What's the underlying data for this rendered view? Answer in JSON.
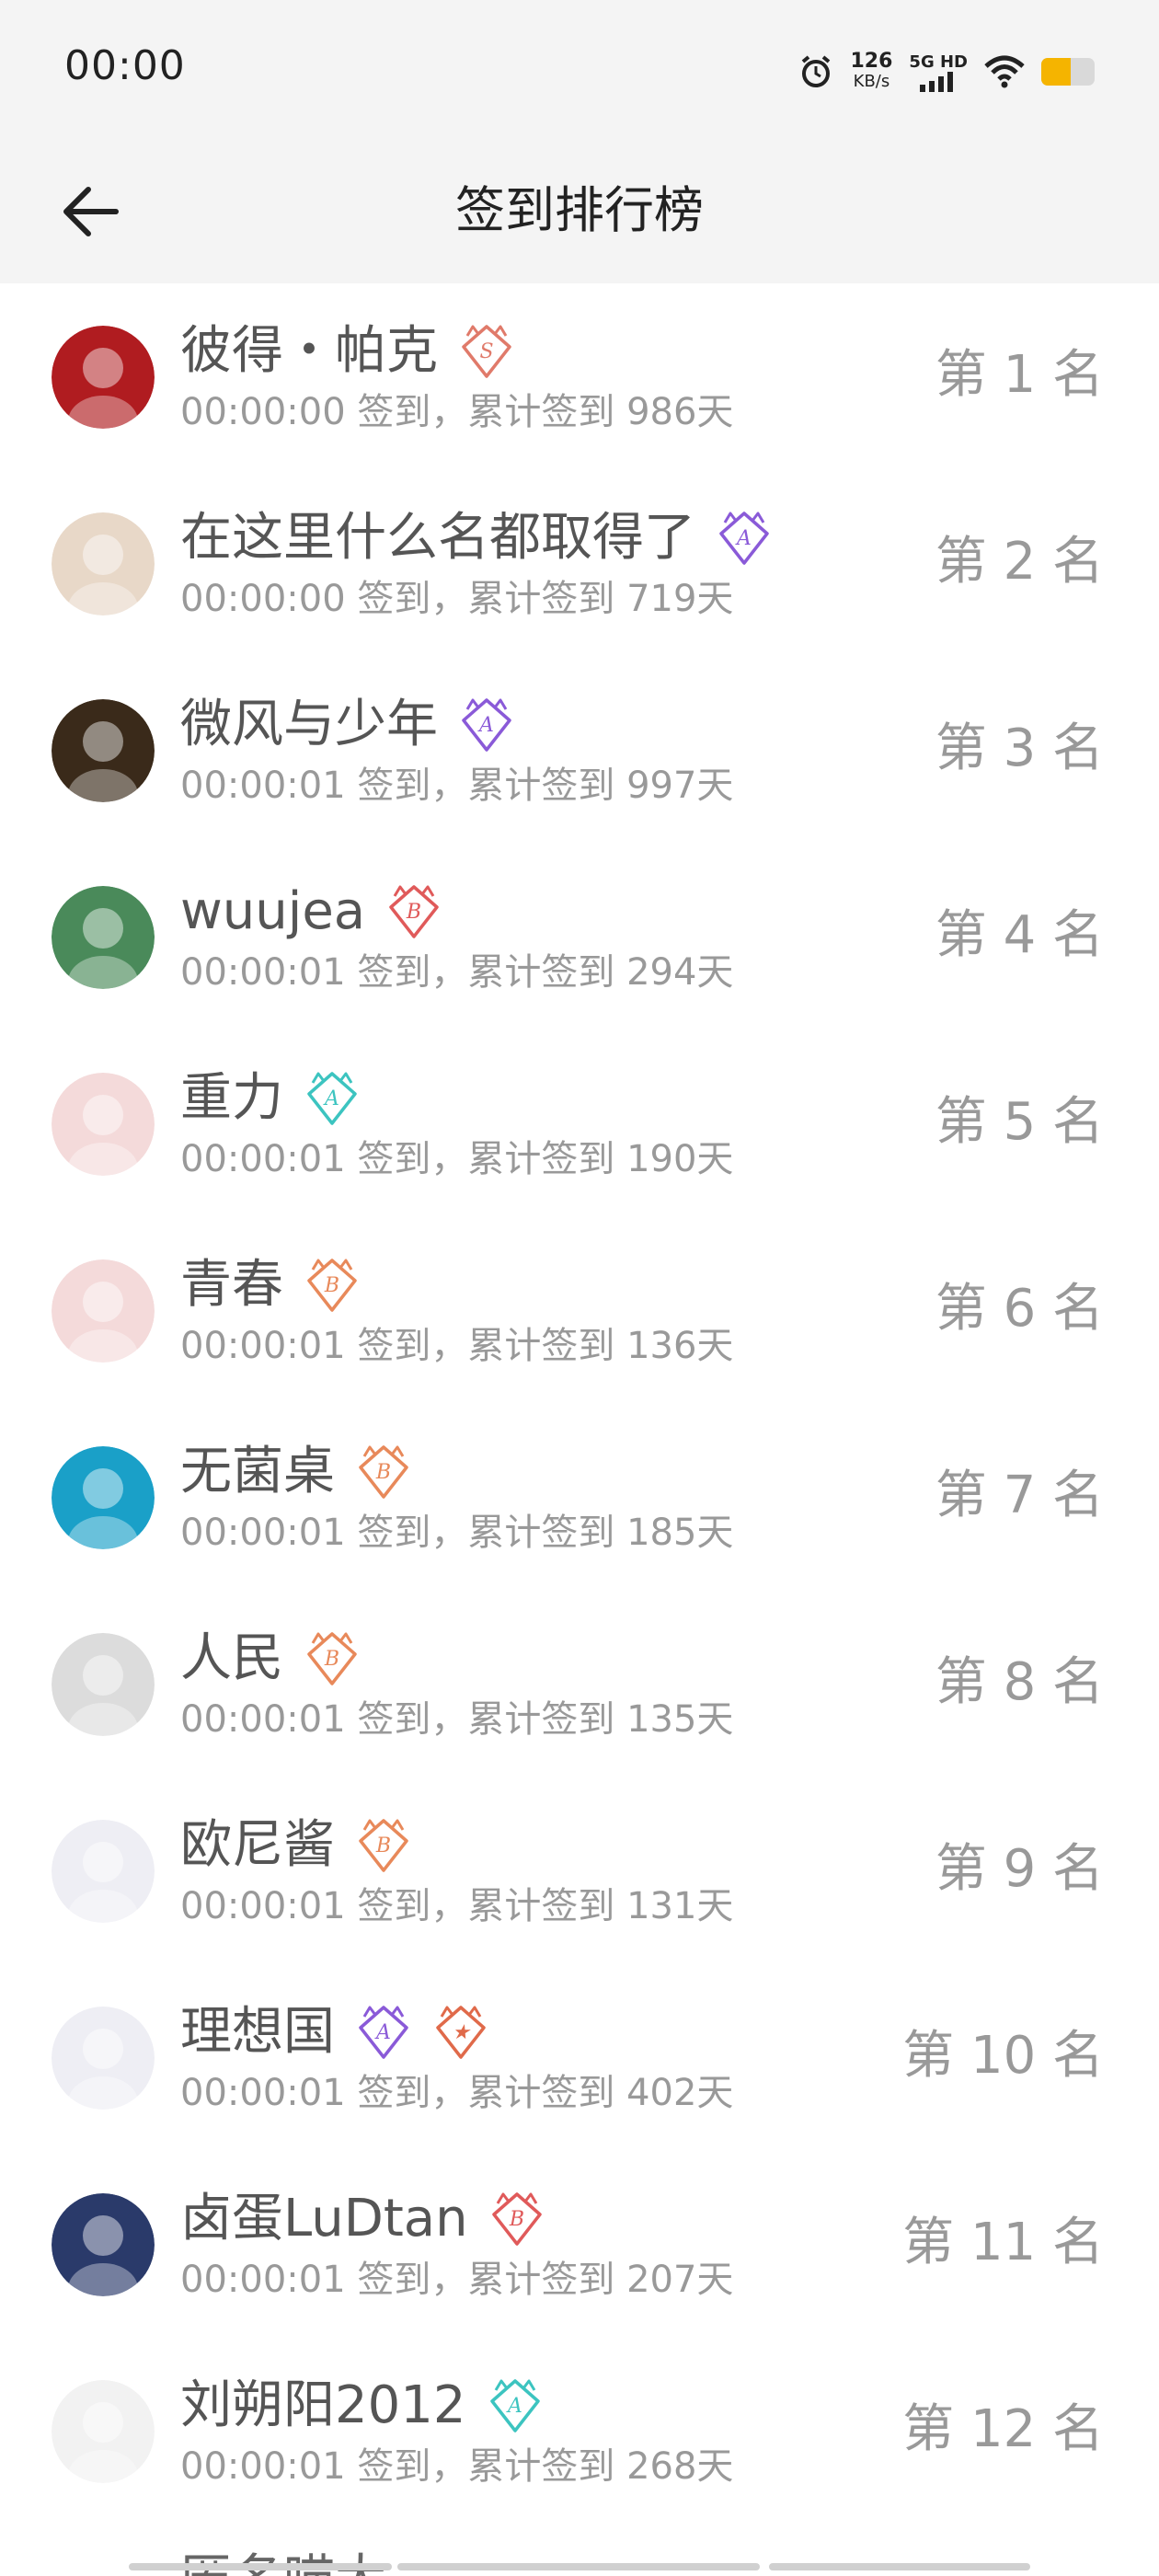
{
  "status_bar": {
    "time": "00:00",
    "speed_value": "126",
    "speed_unit": "KB/s",
    "network": "5G HD",
    "icons": [
      "alarm-icon",
      "signal-icon",
      "wifi-icon",
      "battery-icon"
    ],
    "battery_level": 0.55,
    "battery_color": "#f5b400"
  },
  "header": {
    "title": "签到排行榜",
    "back_icon": "arrow-left-icon"
  },
  "rows": [
    {
      "name": "彼得・帕克",
      "sub": "00:00:00 签到，累计签到 986天",
      "rank": "第 1 名",
      "badges": [
        {
          "letter": "S",
          "color": "#e07a6a"
        }
      ],
      "avatar": "#b01c20"
    },
    {
      "name": "在这里什么名都取得了",
      "sub": "00:00:00 签到，累计签到 719天",
      "rank": "第 2 名",
      "badges": [
        {
          "letter": "A",
          "color": "#8a5ad8"
        }
      ],
      "avatar": "#e8d8c8"
    },
    {
      "name": "微风与少年",
      "sub": "00:00:01 签到，累计签到 997天",
      "rank": "第 3 名",
      "badges": [
        {
          "letter": "A",
          "color": "#8a5ad8"
        }
      ],
      "avatar": "#3a2a1a"
    },
    {
      "name": "wuujea",
      "sub": "00:00:01 签到，累计签到 294天",
      "rank": "第 4 名",
      "badges": [
        {
          "letter": "B",
          "color": "#e05a5a"
        }
      ],
      "avatar": "#4a8a5a"
    },
    {
      "name": "重力",
      "sub": "00:00:01 签到，累计签到 190天",
      "rank": "第 5 名",
      "badges": [
        {
          "letter": "A",
          "color": "#3cc4c0"
        }
      ],
      "avatar": "#f4dada"
    },
    {
      "name": "青春",
      "sub": "00:00:01 签到，累计签到 136天",
      "rank": "第 6 名",
      "badges": [
        {
          "letter": "B",
          "color": "#e8895a"
        }
      ],
      "avatar": "#f4dada"
    },
    {
      "name": "无菌桌",
      "sub": "00:00:01 签到，累计签到 185天",
      "rank": "第 7 名",
      "badges": [
        {
          "letter": "B",
          "color": "#e8895a"
        }
      ],
      "avatar": "#1aa0c8"
    },
    {
      "name": "人民",
      "sub": "00:00:01 签到，累计签到 135天",
      "rank": "第 8 名",
      "badges": [
        {
          "letter": "B",
          "color": "#e8895a"
        }
      ],
      "avatar": "#dcdcdc"
    },
    {
      "name": "欧尼酱",
      "sub": "00:00:01 签到，累计签到 131天",
      "rank": "第 9 名",
      "badges": [
        {
          "letter": "B",
          "color": "#e8895a"
        }
      ],
      "avatar": "#eeeef4"
    },
    {
      "name": "理想国",
      "sub": "00:00:01 签到，累计签到 402天",
      "rank": "第 10 名",
      "badges": [
        {
          "letter": "A",
          "color": "#8a5ad8"
        },
        {
          "letter": "★",
          "color": "#e06a4a"
        }
      ],
      "avatar": "#eeeef4"
    },
    {
      "name": "卤蛋LuDtan",
      "sub": "00:00:01 签到，累计签到 207天",
      "rank": "第 11 名",
      "badges": [
        {
          "letter": "B",
          "color": "#e05a5a"
        }
      ],
      "avatar": "#2a3a6a"
    },
    {
      "name": "刘朔阳2012",
      "sub": "00:00:01 签到，累计签到 268天",
      "rank": "第 12 名",
      "badges": [
        {
          "letter": "A",
          "color": "#3cc4c0"
        }
      ],
      "avatar": "#f2f2f2"
    }
  ],
  "partial_row": {
    "name": "匿名喵大"
  }
}
